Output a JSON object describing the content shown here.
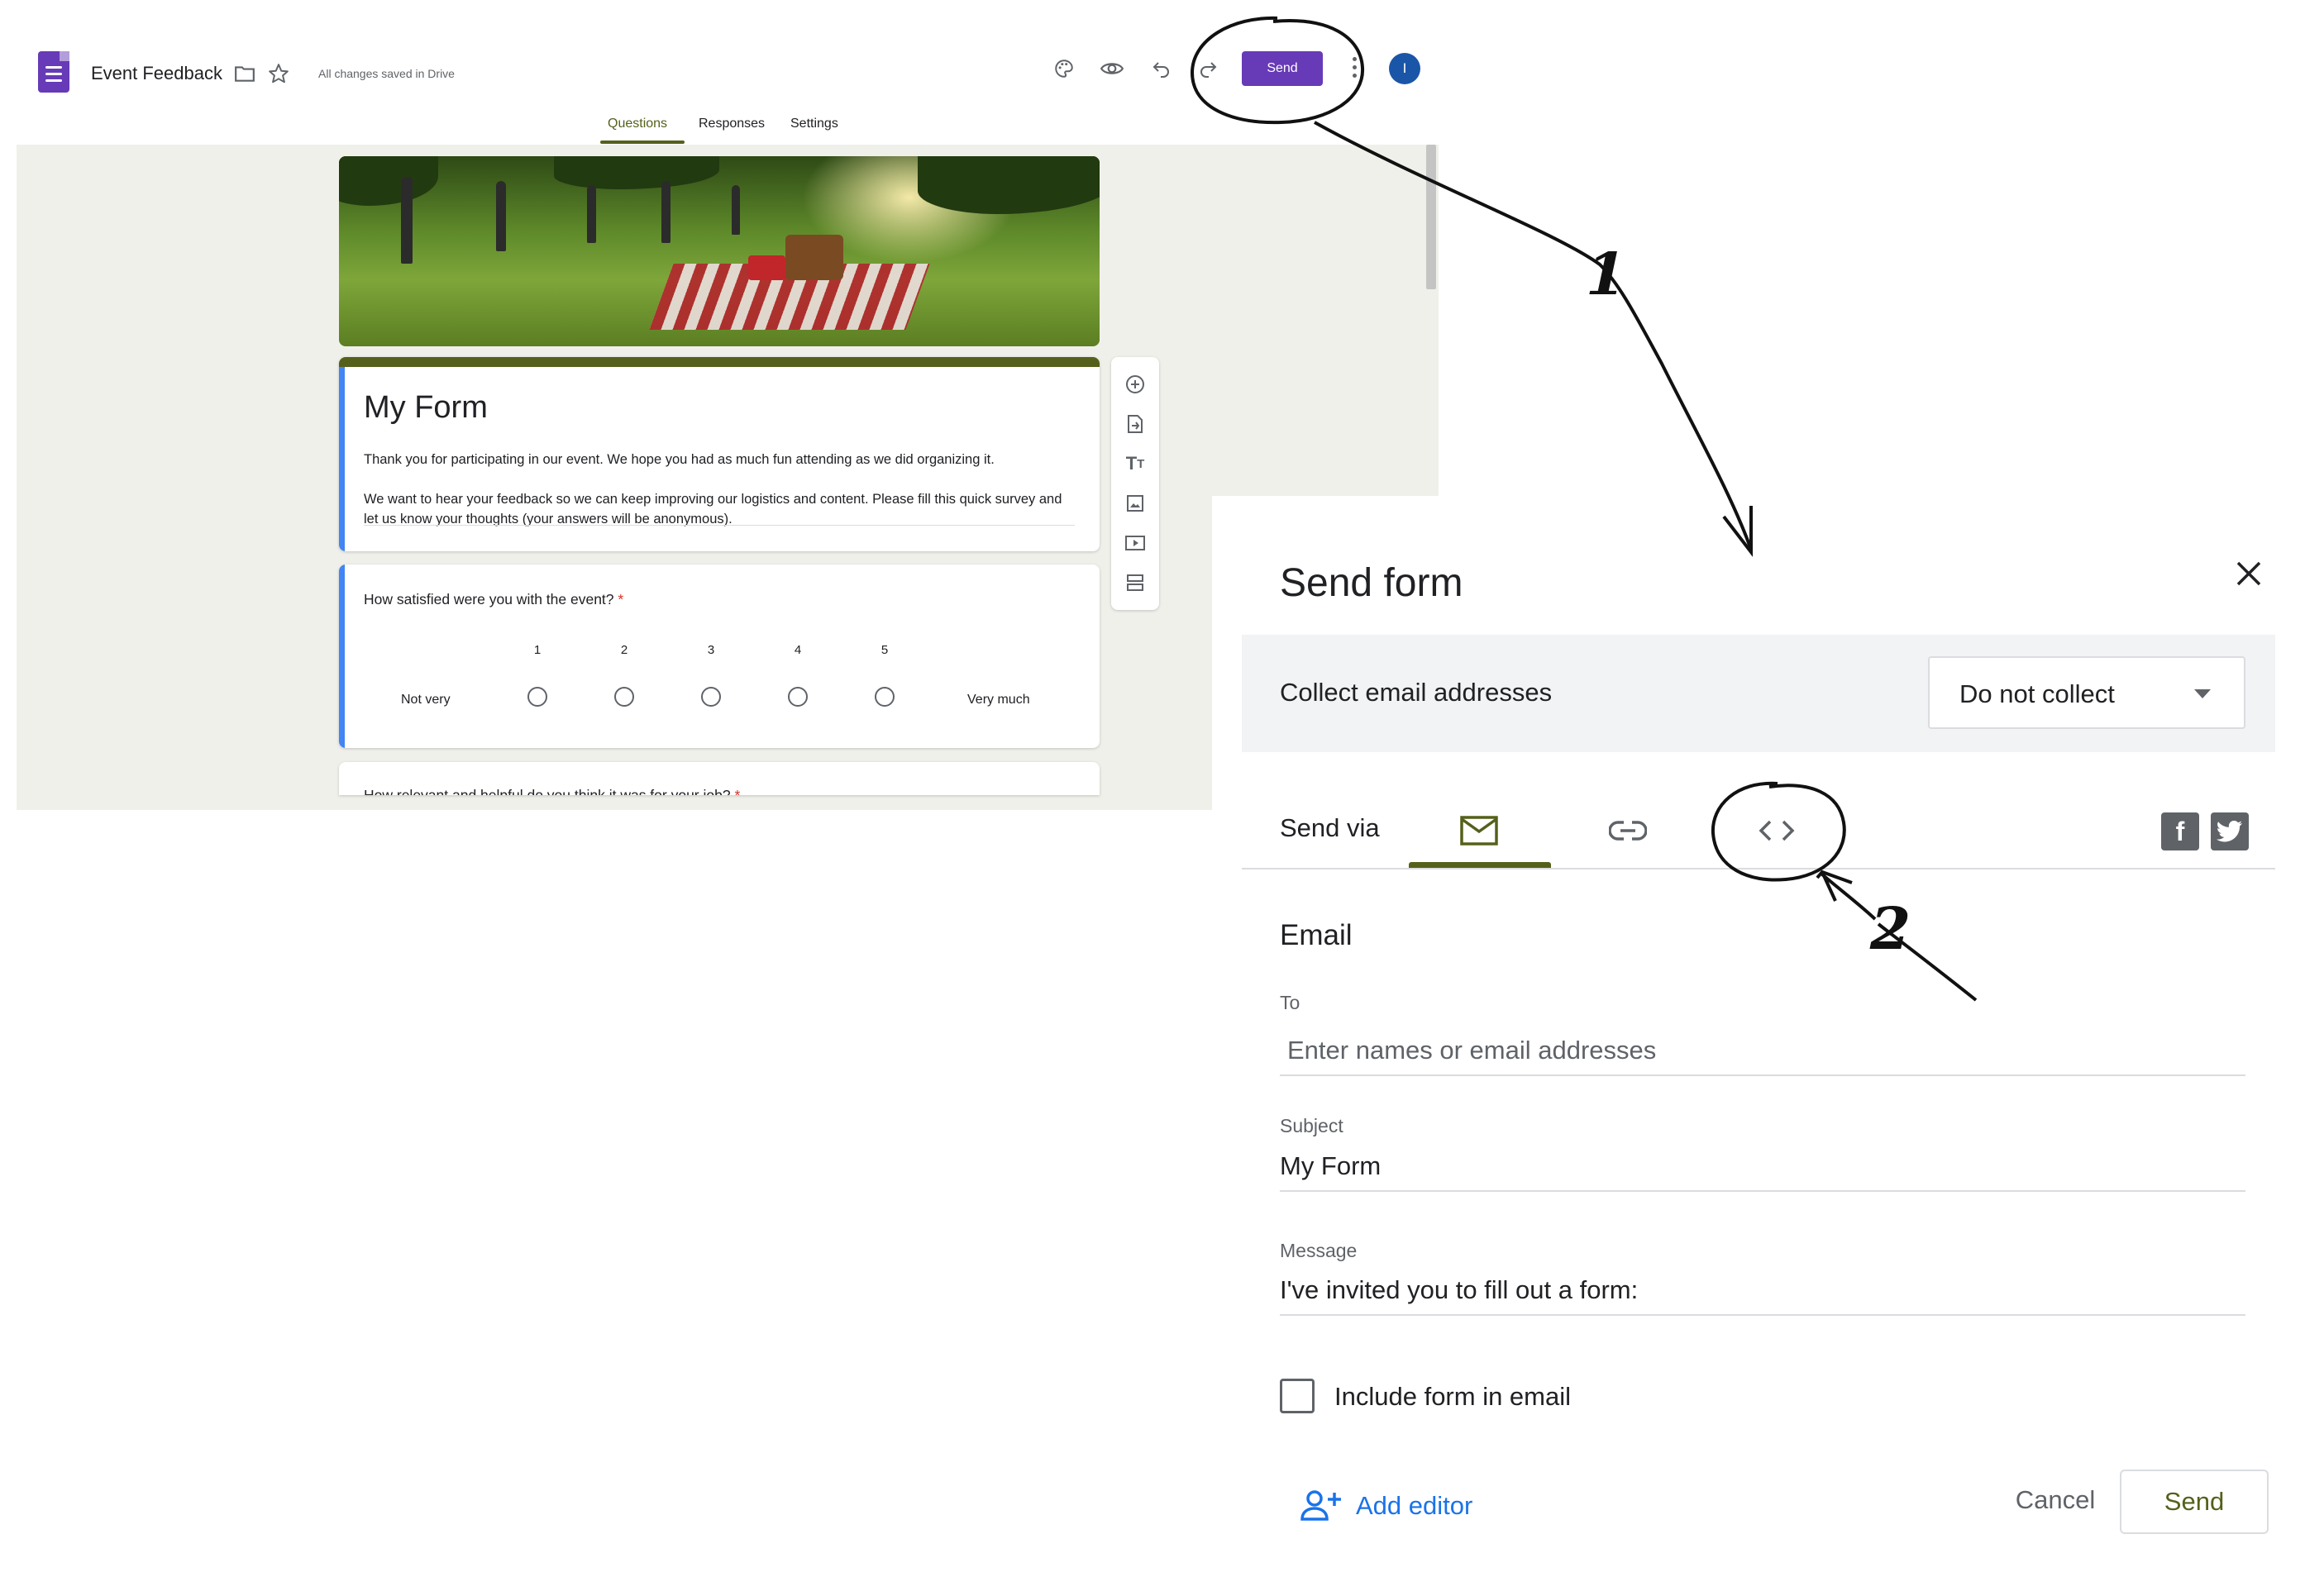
{
  "editor": {
    "title": "Event Feedback",
    "save_status": "All changes saved in Drive",
    "send_label": "Send",
    "avatar_initial": "I",
    "tabs": [
      {
        "label": "Questions",
        "active": true
      },
      {
        "label": "Responses",
        "active": false
      },
      {
        "label": "Settings",
        "active": false
      }
    ],
    "toolbar_icons": [
      "palette-icon",
      "preview-eye-icon",
      "undo-icon",
      "redo-icon",
      "more-vert-icon"
    ],
    "form": {
      "title": "My Form",
      "description_p1": "Thank you for participating in our event. We hope you had as much fun attending as we did organizing it.",
      "description_p2": "We want to hear your feedback so we can keep improving our logistics and content. Please fill this quick survey and let us know your thoughts (your answers will be anonymous).",
      "question1": {
        "text": "How satisfied were you with the event?",
        "required_mark": "*",
        "scale": [
          "1",
          "2",
          "3",
          "4",
          "5"
        ],
        "low_label": "Not very",
        "high_label": "Very much"
      },
      "question2": {
        "text": "How relevant and helpful do you think it was for your job?",
        "required_mark": "*"
      }
    },
    "side_toolbar": [
      "add-question-icon",
      "import-questions-icon",
      "add-title-icon",
      "add-image-icon",
      "add-video-icon",
      "add-section-icon"
    ]
  },
  "dialog": {
    "title": "Send form",
    "collect_label": "Collect email addresses",
    "collect_value": "Do not collect",
    "send_via_label": "Send via",
    "via_tabs": [
      {
        "icon": "email-icon",
        "active": true
      },
      {
        "icon": "link-icon",
        "active": false
      },
      {
        "icon": "embed-code-icon",
        "active": false
      }
    ],
    "social": [
      "facebook-icon",
      "twitter-icon"
    ],
    "email_heading": "Email",
    "to_label": "To",
    "to_placeholder": "Enter names or email addresses",
    "subject_label": "Subject",
    "subject_value": "My Form",
    "message_label": "Message",
    "message_value": "I've invited you to fill out a form:",
    "include_label": "Include form in email",
    "include_checked": false,
    "add_editor_label": "Add editor",
    "cancel_label": "Cancel",
    "send_label": "Send"
  },
  "annotations": {
    "step1": "1",
    "step2": "2"
  },
  "colors": {
    "forms_purple": "#673ab7",
    "theme_olive": "#55601b",
    "accent_blue": "#1a73e8",
    "required_red": "#d93025"
  }
}
